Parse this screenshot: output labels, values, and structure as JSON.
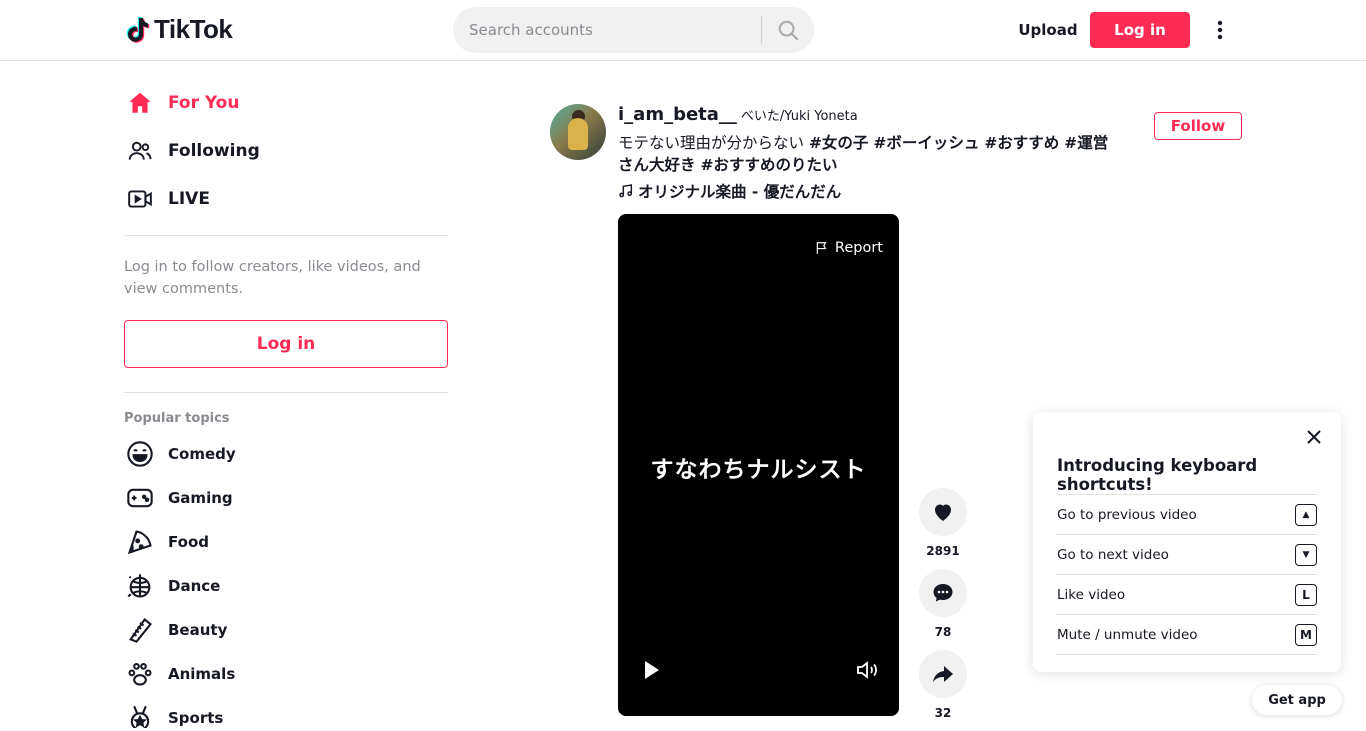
{
  "header": {
    "logo_text": "TikTok",
    "search_placeholder": "Search accounts",
    "upload_label": "Upload",
    "login_label": "Log in"
  },
  "sidebar": {
    "nav": [
      {
        "label": "For You",
        "icon": "home-icon",
        "active": true
      },
      {
        "label": "Following",
        "icon": "users-icon",
        "active": false
      },
      {
        "label": "LIVE",
        "icon": "live-icon",
        "active": false
      }
    ],
    "login_hint": "Log in to follow creators, like videos, and view comments.",
    "login_button": "Log in",
    "topics_title": "Popular topics",
    "topics": [
      {
        "label": "Comedy",
        "icon": "smile-icon"
      },
      {
        "label": "Gaming",
        "icon": "gamepad-icon"
      },
      {
        "label": "Food",
        "icon": "pizza-icon"
      },
      {
        "label": "Dance",
        "icon": "disco-ball-icon"
      },
      {
        "label": "Beauty",
        "icon": "comb-icon"
      },
      {
        "label": "Animals",
        "icon": "paw-icon"
      },
      {
        "label": "Sports",
        "icon": "medal-icon"
      }
    ]
  },
  "post": {
    "username": "i_am_beta__",
    "nickname": "べいた/Yuki Yoneta",
    "caption_text": "モテない理由が分からない ",
    "hashtags": [
      "#女の子",
      "#ボーイッシュ",
      "#おすすめ",
      "#運営さん大好き",
      "#おすすめのりたい"
    ],
    "music": "オリジナル楽曲 - 優だんだん",
    "follow_label": "Follow",
    "report_label": "Report",
    "video_overlay_text": "すなわちナルシスト",
    "likes": "2891",
    "comments": "78",
    "shares": "32"
  },
  "shortcuts": {
    "title": "Introducing keyboard shortcuts!",
    "items": [
      {
        "label": "Go to previous video",
        "key": "▲"
      },
      {
        "label": "Go to next video",
        "key": "▼"
      },
      {
        "label": "Like video",
        "key": "L"
      },
      {
        "label": "Mute / unmute video",
        "key": "M"
      }
    ]
  },
  "get_app_label": "Get app",
  "colors": {
    "accent": "#fe2c55",
    "text": "#161823",
    "muted": "#8a8b91"
  }
}
